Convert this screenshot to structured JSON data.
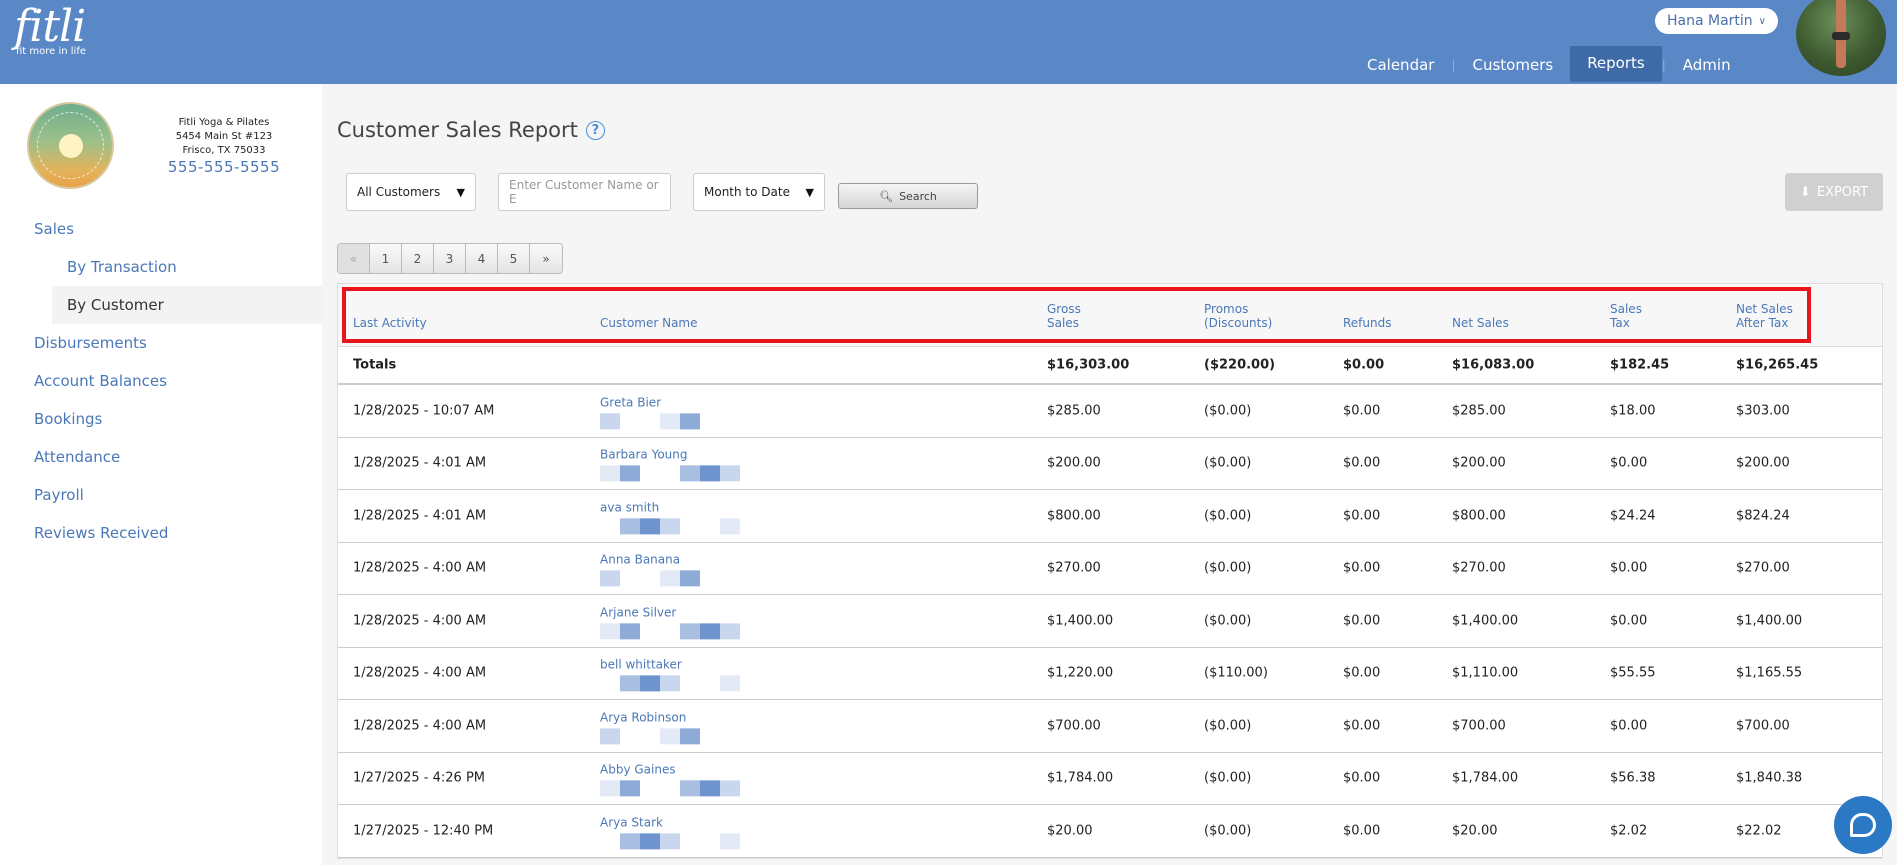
{
  "header": {
    "logo": "fitli",
    "tagline": "fit more in life",
    "user_name": "Hana Martin",
    "nav": [
      "Calendar",
      "Customers",
      "Reports",
      "Admin"
    ],
    "active_nav": "Reports"
  },
  "studio": {
    "name": "Fitli Yoga & Pilates",
    "address1": "5454 Main St #123",
    "address2": "Frisco, TX 75033",
    "phone": "555-555-5555"
  },
  "sidebar": {
    "items": [
      {
        "label": "Sales",
        "level": 0
      },
      {
        "label": "By Transaction",
        "level": 1
      },
      {
        "label": "By Customer",
        "level": 1,
        "active": true
      },
      {
        "label": "Disbursements",
        "level": 0
      },
      {
        "label": "Account Balances",
        "level": 0
      },
      {
        "label": "Bookings",
        "level": 0
      },
      {
        "label": "Attendance",
        "level": 0
      },
      {
        "label": "Payroll",
        "level": 0
      },
      {
        "label": "Reviews Received",
        "level": 0
      }
    ]
  },
  "report": {
    "title": "Customer Sales Report",
    "customer_filter": "All Customers",
    "search_placeholder": "Enter Customer Name or E",
    "date_filter": "Month to Date",
    "search_label": "Search",
    "export_label": "EXPORT",
    "pages": [
      "«",
      "1",
      "2",
      "3",
      "4",
      "5",
      "»"
    ]
  },
  "table": {
    "headers": [
      [
        "Last Activity"
      ],
      [
        "Customer Name"
      ],
      [
        "Gross",
        "Sales"
      ],
      [
        "Promos",
        "(Discounts)"
      ],
      [
        "Refunds"
      ],
      [
        "Net Sales"
      ],
      [
        "Sales",
        "Tax"
      ],
      [
        "Net Sales",
        "After Tax"
      ]
    ],
    "totals": [
      "Totals",
      "",
      "$16,303.00",
      "($220.00)",
      "$0.00",
      "$16,083.00",
      "$182.45",
      "$16,265.45"
    ],
    "rows": [
      [
        "1/28/2025 - 10:07 AM",
        "Greta Bier",
        "$285.00",
        "($0.00)",
        "$0.00",
        "$285.00",
        "$18.00",
        "$303.00"
      ],
      [
        "1/28/2025 - 4:01 AM",
        "Barbara Young",
        "$200.00",
        "($0.00)",
        "$0.00",
        "$200.00",
        "$0.00",
        "$200.00"
      ],
      [
        "1/28/2025 - 4:01 AM",
        "ava smith",
        "$800.00",
        "($0.00)",
        "$0.00",
        "$800.00",
        "$24.24",
        "$824.24"
      ],
      [
        "1/28/2025 - 4:00 AM",
        "Anna Banana",
        "$270.00",
        "($0.00)",
        "$0.00",
        "$270.00",
        "$0.00",
        "$270.00"
      ],
      [
        "1/28/2025 - 4:00 AM",
        "Arjane Silver",
        "$1,400.00",
        "($0.00)",
        "$0.00",
        "$1,400.00",
        "$0.00",
        "$1,400.00"
      ],
      [
        "1/28/2025 - 4:00 AM",
        "bell whittaker",
        "$1,220.00",
        "($110.00)",
        "$0.00",
        "$1,110.00",
        "$55.55",
        "$1,165.55"
      ],
      [
        "1/28/2025 - 4:00 AM",
        "Arya Robinson",
        "$700.00",
        "($0.00)",
        "$0.00",
        "$700.00",
        "$0.00",
        "$700.00"
      ],
      [
        "1/27/2025 - 4:26 PM",
        "Abby Gaines",
        "$1,784.00",
        "($0.00)",
        "$0.00",
        "$1,784.00",
        "$56.38",
        "$1,840.38"
      ],
      [
        "1/27/2025 - 12:40 PM",
        "Arya Stark",
        "$20.00",
        "($0.00)",
        "$0.00",
        "$20.00",
        "$2.02",
        "$22.02"
      ]
    ]
  },
  "colors": {
    "header_bg": "#5a87c6",
    "link": "#4a78b8",
    "highlight": "#e8141e"
  }
}
